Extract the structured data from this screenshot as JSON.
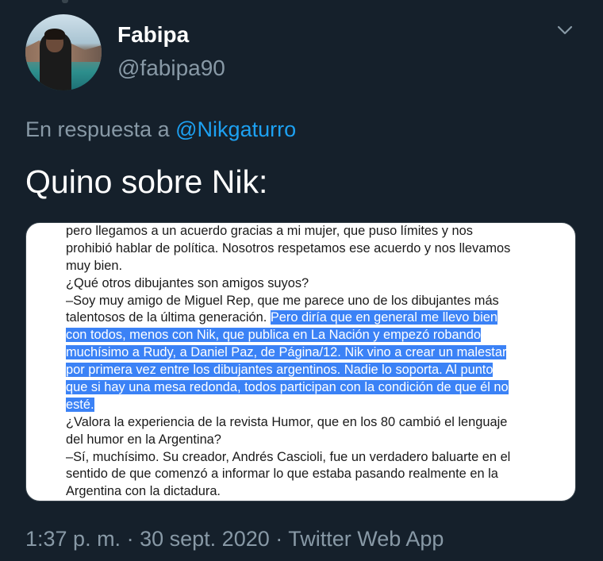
{
  "tweet": {
    "author": {
      "display_name": "Fabipa",
      "handle": "@fabipa90"
    },
    "reply_prefix": "En respuesta a",
    "reply_mention": "@Nikgaturro",
    "text": "Quino sobre Nik:",
    "image_text": {
      "lines": [
        {
          "plain": "pero llegamos a un acuerdo gracias a mi mujer, que puso límites y nos",
          "highlight": ""
        },
        {
          "plain": "prohibió hablar de política. Nosotros respetamos ese acuerdo y nos llevamos",
          "highlight": ""
        },
        {
          "plain": "muy bien.",
          "highlight": ""
        },
        {
          "plain": "¿Qué otros dibujantes son amigos suyos?",
          "highlight": ""
        },
        {
          "plain": "–Soy muy amigo de Miguel Rep, que me parece uno de los dibujantes más",
          "highlight": ""
        },
        {
          "plain": "talentosos de la última generación. ",
          "highlight": "Pero diría que en general me llevo bien"
        },
        {
          "plain": "",
          "highlight": "con todos, menos con Nik, que publica en La Nación y empezó robando"
        },
        {
          "plain": "",
          "highlight": "muchísimo a Rudy, a Daniel Paz, de Página/12. Nik vino a crear un malestar"
        },
        {
          "plain": "",
          "highlight": "por primera vez entre los dibujantes argentinos. Nadie lo soporta. Al punto"
        },
        {
          "plain": "",
          "highlight": "que si hay una mesa redonda, todos participan con la condición de que él no"
        },
        {
          "plain": "",
          "highlight": "esté."
        },
        {
          "plain": "¿Valora la experiencia de la revista Humor, que en los 80 cambió el lenguaje",
          "highlight": ""
        },
        {
          "plain": "del humor en la Argentina?",
          "highlight": ""
        },
        {
          "plain": "–Sí, muchísimo. Su creador, Andrés Cascioli, fue un verdadero baluarte en el",
          "highlight": ""
        },
        {
          "plain": "sentido de que comenzó a informar lo que estaba pasando realmente en la",
          "highlight": ""
        },
        {
          "plain": "Argentina con la dictadura.",
          "highlight": ""
        }
      ]
    },
    "time": "1:37 p. m.",
    "separator": "·",
    "date": "30 sept. 2020",
    "source": "Twitter Web App"
  },
  "colors": {
    "background": "#15202b",
    "primary_text": "#ffffff",
    "secondary_text": "#8899a6",
    "link": "#1da1f2",
    "highlight": "#3b82f6"
  },
  "icons": {
    "menu": "chevron-down-icon"
  }
}
